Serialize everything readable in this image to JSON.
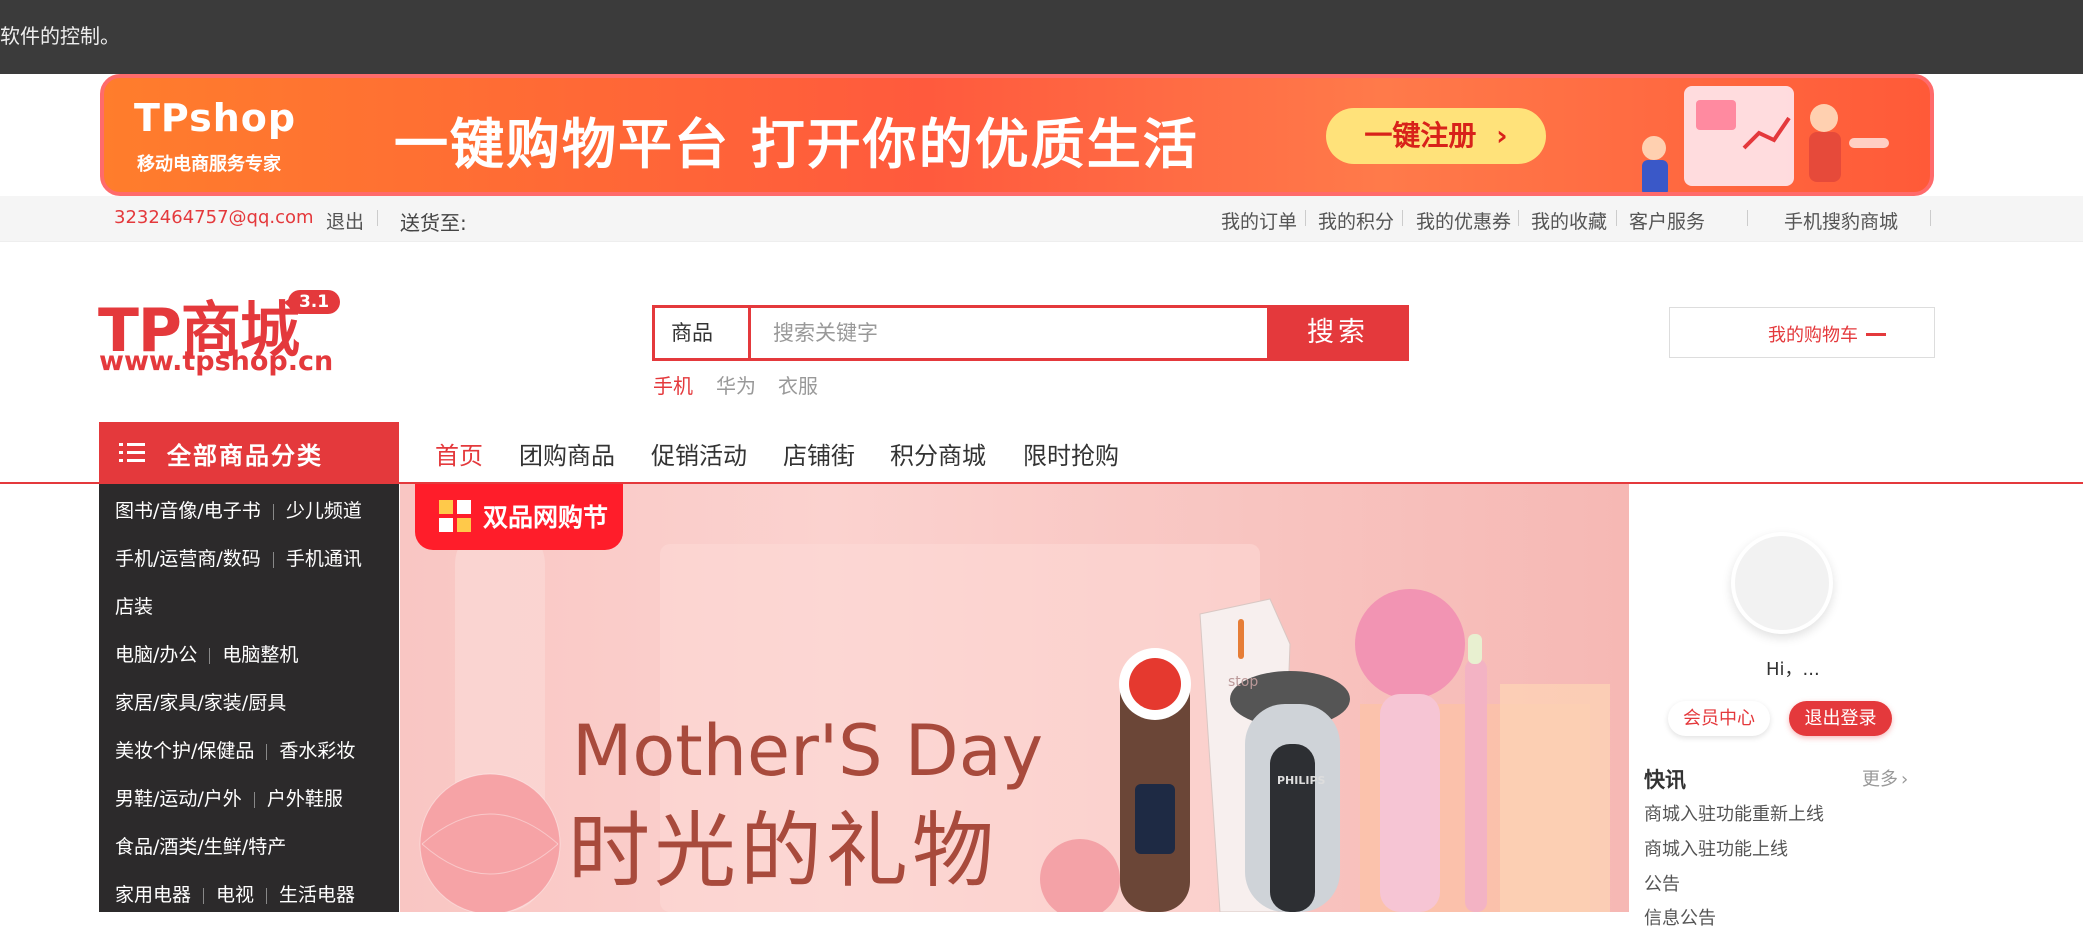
{
  "automation_bar": {
    "text": "软件的控制。"
  },
  "banner": {
    "logo": "TPshop",
    "logo_sub": "移动电商服务专家",
    "slogan": "一键购物平台 打开你的优质生活",
    "cta": "一键注册",
    "cta_arrow": "›"
  },
  "topbar": {
    "email": "3232464757@qq.com",
    "logout": "退出",
    "ship_to": "送货至:",
    "links": [
      "我的订单",
      "我的积分",
      "我的优惠券",
      "我的收藏",
      "客户服务",
      "手机搜豹商城"
    ]
  },
  "logo": {
    "main": "TP商城",
    "version": "3.1",
    "url": "www.tpshop.cn"
  },
  "search": {
    "category": "商品",
    "placeholder": "搜索关键字",
    "button": "搜索",
    "hot_words": [
      "手机",
      "华为",
      "衣服"
    ]
  },
  "cart": {
    "label": "我的购物车"
  },
  "category_header": "全部商品分类",
  "main_nav": [
    "首页",
    "团购商品",
    "促销活动",
    "店铺街",
    "积分商城",
    "限时抢购"
  ],
  "categories": [
    [
      "图书/音像/电子书",
      "少儿频道"
    ],
    [
      "手机/运营商/数码",
      "手机通讯"
    ],
    [
      "店装"
    ],
    [
      "电脑/办公",
      "电脑整机"
    ],
    [
      "家居/家具/家装/厨具"
    ],
    [
      "美妆个护/保健品",
      "香水彩妆"
    ],
    [
      "男鞋/运动/户外",
      "户外鞋服"
    ],
    [
      "食品/酒类/生鲜/特产"
    ],
    [
      "家用电器",
      "电视",
      "生活电器"
    ]
  ],
  "hero": {
    "tag": "双品网购节",
    "title1": "Mother'S Day",
    "title2": "时光的礼物",
    "product_text": "stop",
    "product_brand": "PHILIPS"
  },
  "user_panel": {
    "greeting": "Hi，...",
    "member_center": "会员中心",
    "logout": "退出登录",
    "news_title": "快讯",
    "news_more": "更多",
    "news_more_arrow": "›",
    "news_items": [
      "商城入驻功能重新上线",
      "商城入驻功能上线",
      "公告",
      "信息公告"
    ]
  },
  "colors": {
    "brand_red": "#e4393c",
    "dark": "#2c2a2b",
    "banner_orange": "#ff5a3d"
  }
}
